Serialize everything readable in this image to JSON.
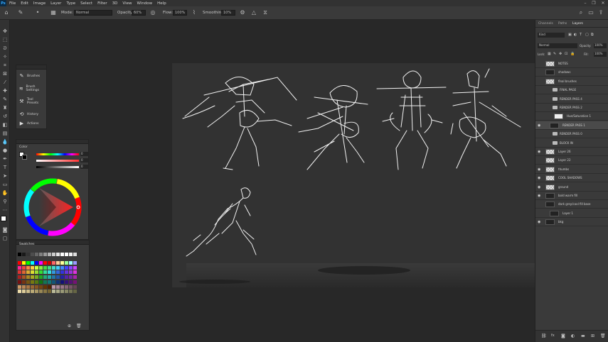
{
  "menubar": {
    "logo": "Ps",
    "items": [
      "File",
      "Edit",
      "Image",
      "Layer",
      "Type",
      "Select",
      "Filter",
      "3D",
      "View",
      "Window",
      "Help"
    ],
    "window_controls": [
      "–",
      "❐",
      "✕"
    ]
  },
  "options": {
    "mode_label": "Mode:",
    "mode_value": "Normal",
    "opacity_label": "Opacity:",
    "opacity_value": "60%",
    "flow_label": "Flow:",
    "flow_value": "100%",
    "smoothing_label": "Smoothing:",
    "smoothing_value": "10%"
  },
  "mini_panel": {
    "items": [
      {
        "icon": "brush-icon",
        "glyph": "✎",
        "label": "Brushes"
      },
      {
        "icon": "brush-settings-icon",
        "glyph": "≋",
        "label": "Brush Settings"
      },
      {
        "icon": "tool-presets-icon",
        "glyph": "⚒",
        "label": "Tool Presets"
      },
      {
        "icon": "history-icon",
        "glyph": "⟲",
        "label": "History"
      },
      {
        "icon": "actions-icon",
        "glyph": "▶",
        "label": "Actions"
      }
    ]
  },
  "color_panel": {
    "title": "Color",
    "fields": [
      "0",
      "0",
      "0"
    ],
    "units": [
      "%",
      "%",
      "%"
    ]
  },
  "swatches_panel": {
    "title": "Swatches"
  },
  "right_panel": {
    "tabs": [
      "Channels",
      "Paths",
      "Layers"
    ],
    "kind_label": "Kind",
    "blend_mode": "Normal",
    "opacity_label": "Opacity:",
    "opacity_value": "100%",
    "lock_label": "Lock:",
    "fill_label": "Fill:",
    "fill_value": "100%",
    "layers": [
      {
        "name": "NOTES",
        "visible": false,
        "thumb": "checker",
        "indent": 0
      },
      {
        "name": "shadows",
        "visible": false,
        "thumb": "dark",
        "indent": 0
      },
      {
        "name": "final brushes",
        "visible": false,
        "thumb": "checker",
        "indent": 0
      },
      {
        "name": "FINAL PAGE",
        "visible": false,
        "thumb": "folder",
        "indent": 1
      },
      {
        "name": "RENDER PASS 4",
        "visible": false,
        "thumb": "folder",
        "indent": 1
      },
      {
        "name": "RENDER PASS 2",
        "visible": false,
        "thumb": "folder",
        "indent": 1
      },
      {
        "name": "Hue/Saturation 1",
        "visible": false,
        "thumb": "white",
        "indent": 2
      },
      {
        "name": "RENDER PASS 1",
        "visible": true,
        "thumb": "dark",
        "indent": 1
      },
      {
        "name": "RENDER PASS 0",
        "visible": false,
        "thumb": "folder",
        "indent": 1
      },
      {
        "name": "BLOCK IN",
        "visible": false,
        "thumb": "folder",
        "indent": 1
      },
      {
        "name": "Layer 26",
        "visible": true,
        "thumb": "checker",
        "indent": 0
      },
      {
        "name": "Layer 22",
        "visible": false,
        "thumb": "checker",
        "indent": 0
      },
      {
        "name": "thumbs",
        "visible": true,
        "thumb": "checker",
        "indent": 0
      },
      {
        "name": "COOL SHADOWS",
        "visible": true,
        "thumb": "checker",
        "indent": 0
      },
      {
        "name": "ground",
        "visible": true,
        "thumb": "checker",
        "indent": 0
      },
      {
        "name": "bold warm fill",
        "visible": true,
        "thumb": "dark",
        "indent": 0
      },
      {
        "name": "dark grey/cool fill base",
        "visible": false,
        "thumb": "dark",
        "indent": 0
      },
      {
        "name": "Layer 1",
        "visible": false,
        "thumb": "dark",
        "indent": 1
      },
      {
        "name": "bkg",
        "visible": true,
        "thumb": "dark",
        "indent": 0
      }
    ],
    "footer_icons": [
      "link-icon",
      "fx-icon",
      "mask-icon",
      "adjustment-icon",
      "group-icon",
      "new-layer-icon",
      "trash-icon"
    ]
  }
}
